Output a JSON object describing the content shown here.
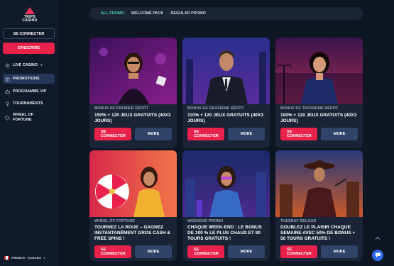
{
  "sidebar": {
    "logo_text": "TRIPS\nCASINO",
    "login_label": "SE CONNECTER",
    "signup_label": "S'INSCRIRE",
    "live_casino": "LIVE CASINO",
    "promotions": "PROMOTIONS",
    "vip": "PROGRAMME VIP",
    "tournaments": "TOURNAMENTS",
    "wheel": "WHEEL OF FORTUNE",
    "language": "FRENCH - CANADA"
  },
  "tabs": [
    {
      "label": "ALL PROMO",
      "active": true
    },
    {
      "label": "WELCOME PACK",
      "active": false
    },
    {
      "label": "REGULAR PROMO",
      "active": false
    }
  ],
  "cards": [
    {
      "category": "BONUS DE PREMIER DÉPÔT",
      "title": "150% + 120 JEUX GRATUITS (40X3 JOURS)",
      "btn_login": "SE CONNECTER",
      "btn_more": "MORE"
    },
    {
      "category": "BONUS DE DEUXIÈME DÉPÔT",
      "title": "110% + 120 JEUX GRATUITS (40X3 JOURS)",
      "btn_login": "SE CONNECTER",
      "btn_more": "MORE"
    },
    {
      "category": "BONUS DE TROISIÈME DÉPÔT",
      "title": "100% + 120 JEUX GRATUITS (40X3 JOURS)",
      "btn_login": "SE CONNECTER",
      "btn_more": "MORE"
    },
    {
      "category": "WHEEL OF FORTUNE",
      "title": "TOURNEZ LA ROUE – GAGNEZ INSTANTANÉMENT GROS CASH & FREE SPINS !",
      "btn_login": "SE CONNECTER",
      "btn_more": "MORE"
    },
    {
      "category": "WEEKEND PROMO",
      "title": "CHAQUE WEEK-END : LE BONUS DE 100 % LE PLUS CHAUD ET 90 TOURS GRATUITS !",
      "btn_login": "SE CONNECTER",
      "btn_more": "MORE"
    },
    {
      "category": "TUESDAY RELOAD",
      "title": "DOUBLEZ LE PLAISIR CHAQUE SEMAINE AVEC 50% DE BONUS + 50 TOURS GRATUITS !",
      "btn_login": "SE CONNECTER",
      "btn_more": "MORE"
    }
  ],
  "colors": {
    "accent": "#e8224a",
    "active_tab": "#4fd1a5",
    "more_button": "#2e4469",
    "background": "#0e1523"
  },
  "icons": {
    "chat": "chat-icon",
    "scroll_top": "chevron-up-icon"
  }
}
